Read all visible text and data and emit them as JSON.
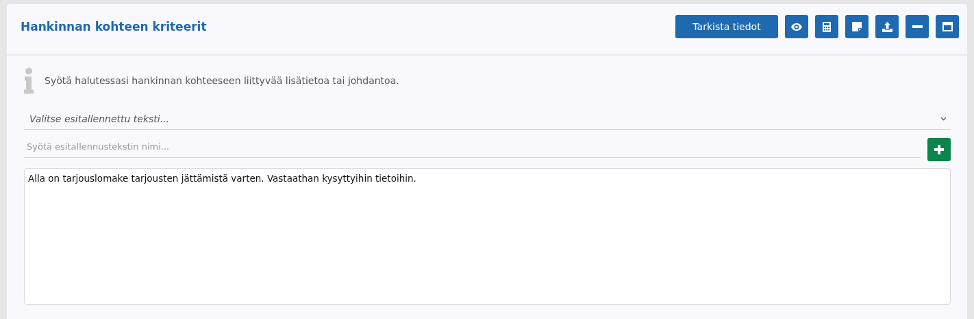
{
  "panel": {
    "title": "Hankinnan kohteen kriteerit"
  },
  "check_button": {
    "label": "Tarkista tiedot"
  },
  "info": {
    "text": "Syötä halutessasi hankinnan kohteeseen liittyvää lisätietoa tai johdantoa."
  },
  "preset_select": {
    "placeholder": "Valitse esitallennettu teksti..."
  },
  "preset_name": {
    "placeholder": "Syötä esitallennustekstin nimi..."
  },
  "text_area": {
    "value": "Alla on tarjouslomake tarjousten jättämistä varten. Vastaathan kysyttyihin tietoihin."
  }
}
